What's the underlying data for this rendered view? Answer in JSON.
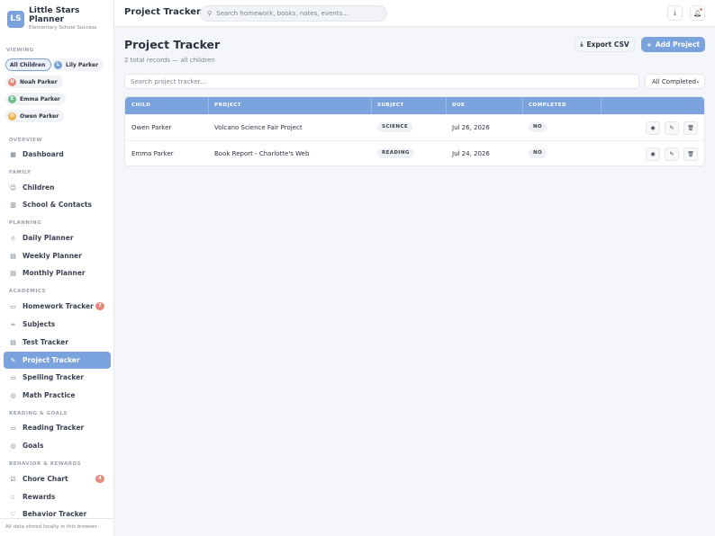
{
  "brand": {
    "initials": "LS",
    "name": "Little Stars Planner",
    "tagline": "Elementary School Success"
  },
  "viewing": {
    "label": "VIEWING",
    "children": [
      {
        "label": "All Children",
        "initial": "",
        "color": ""
      },
      {
        "label": "Lily Parker",
        "initial": "L",
        "color": "#7aa3dd"
      },
      {
        "label": "Noah Parker",
        "initial": "N",
        "color": "#e78b7f"
      },
      {
        "label": "Emma Parker",
        "initial": "E",
        "color": "#6bbf8a"
      },
      {
        "label": "Owen Parker",
        "initial": "O",
        "color": "#f0b34a"
      }
    ]
  },
  "nav": {
    "overview": "OVERVIEW",
    "family": "FAMILY",
    "planning": "PLANNING",
    "academics": "ACADEMICS",
    "reading": "READING & GOALS",
    "behavior": "BEHAVIOR & REWARDS",
    "items": {
      "dashboard": "Dashboard",
      "children": "Children",
      "school": "School & Contacts",
      "daily": "Daily Planner",
      "weekly": "Weekly Planner",
      "monthly": "Monthly Planner",
      "homework": "Homework Tracker",
      "homework_badge": "7",
      "subjects": "Subjects",
      "test": "Test Tracker",
      "project": "Project Tracker",
      "spelling": "Spelling Tracker",
      "math": "Math Practice",
      "reading_tracker": "Reading Tracker",
      "goals": "Goals",
      "chore": "Chore Chart",
      "chore_badge": "4",
      "rewards": "Rewards",
      "behavior_tracker": "Behavior Tracker"
    }
  },
  "footer": "All data stored locally in this browser.",
  "topbar": {
    "title": "Project Tracker",
    "search_placeholder": "Search homework, books, notes, events..."
  },
  "page": {
    "title": "Project Tracker",
    "subtitle": "2 total records — all children",
    "export_label": "Export CSV",
    "add_label": "Add Project",
    "filter_placeholder": "Search project tracker...",
    "filter_select": "All Completed"
  },
  "table": {
    "headers": [
      "CHILD",
      "PROJECT",
      "SUBJECT",
      "DUE",
      "COMPLETED"
    ],
    "rows": [
      {
        "child": "Owen Parker",
        "project": "Volcano Science Fair Project",
        "subject": "SCIENCE",
        "due": "Jul 26, 2026",
        "completed": "NO"
      },
      {
        "child": "Emma Parker",
        "project": "Book Report - Charlotte's Web",
        "subject": "READING",
        "due": "Jul 24, 2026",
        "completed": "NO"
      }
    ]
  },
  "colors": {
    "accent": "#7aa3dd",
    "badge": "#e78b7f"
  }
}
